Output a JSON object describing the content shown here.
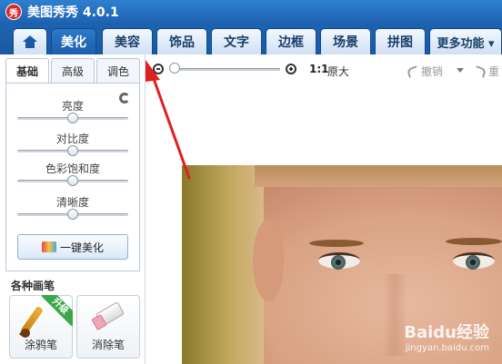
{
  "app": {
    "logo_text": "秀",
    "title": "美图秀秀 4.0.1"
  },
  "menu": {
    "tabs": [
      {
        "label": "美化",
        "active": true
      },
      {
        "label": "美容",
        "active": false
      },
      {
        "label": "饰品",
        "active": false
      },
      {
        "label": "文字",
        "active": false
      },
      {
        "label": "边框",
        "active": false
      },
      {
        "label": "场景",
        "active": false
      },
      {
        "label": "拼图",
        "active": false
      },
      {
        "label": "更多功能 ▾",
        "active": false
      }
    ]
  },
  "left_panel": {
    "subtabs": [
      {
        "label": "基础",
        "active": true
      },
      {
        "label": "高级",
        "active": false
      },
      {
        "label": "调色",
        "active": false
      }
    ],
    "sliders": [
      {
        "label": "亮度",
        "value": 0.5
      },
      {
        "label": "对比度",
        "value": 0.5
      },
      {
        "label": "色彩饱和度",
        "value": 0.5
      },
      {
        "label": "清晰度",
        "value": 0.5
      }
    ],
    "one_click_label": "一键美化",
    "section_title": "各种画笔",
    "tools": [
      {
        "label": "涂鸦笔",
        "badge": "升级"
      },
      {
        "label": "消除笔"
      }
    ]
  },
  "toolbar": {
    "ratio_label": "1:1",
    "original_label": "原大",
    "undo_label": "撤销",
    "redo_label": "重"
  },
  "canvas": {
    "watermark": "Baidu经验",
    "watermark_url": "jingyan.baidu.com"
  },
  "colors": {
    "titlebar": "#1d62b0",
    "annotation_arrow": "#e02020"
  }
}
